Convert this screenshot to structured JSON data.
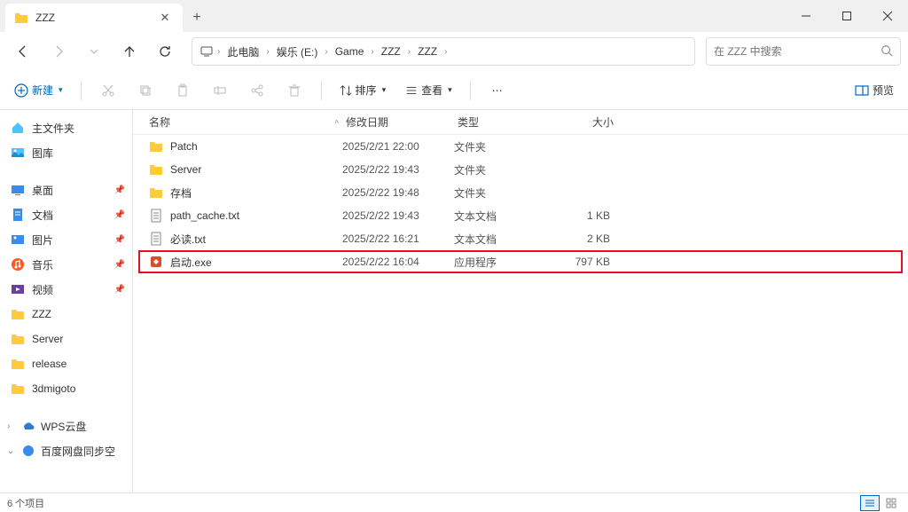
{
  "window": {
    "title": "ZZZ"
  },
  "toolbar": {
    "new_label": "新建",
    "sort_label": "排序",
    "view_label": "查看",
    "preview_label": "预览"
  },
  "breadcrumb": [
    "此电脑",
    "娱乐 (E:)",
    "Game",
    "ZZZ",
    "ZZZ"
  ],
  "search": {
    "placeholder": "在 ZZZ 中搜索"
  },
  "sidebar": {
    "home": "主文件夹",
    "gallery": "图库",
    "quick": [
      {
        "label": "桌面",
        "pinned": true,
        "icon": "desktop"
      },
      {
        "label": "文档",
        "pinned": true,
        "icon": "document"
      },
      {
        "label": "图片",
        "pinned": true,
        "icon": "picture"
      },
      {
        "label": "音乐",
        "pinned": true,
        "icon": "music"
      },
      {
        "label": "视频",
        "pinned": true,
        "icon": "video"
      },
      {
        "label": "ZZZ",
        "pinned": false,
        "icon": "folder"
      },
      {
        "label": "Server",
        "pinned": false,
        "icon": "folder"
      },
      {
        "label": "release",
        "pinned": false,
        "icon": "folder"
      },
      {
        "label": "3dmigoto",
        "pinned": false,
        "icon": "folder"
      }
    ],
    "cloud": [
      {
        "label": "WPS云盘",
        "expand": ">"
      },
      {
        "label": "百度网盘同步空",
        "expand": "v"
      }
    ]
  },
  "columns": {
    "name": "名称",
    "date": "修改日期",
    "type": "类型",
    "size": "大小"
  },
  "files": [
    {
      "name": "Patch",
      "date": "2025/2/21 22:00",
      "type": "文件夹",
      "size": "",
      "icon": "folder",
      "highlight": false
    },
    {
      "name": "Server",
      "date": "2025/2/22 19:43",
      "type": "文件夹",
      "size": "",
      "icon": "folder",
      "highlight": false
    },
    {
      "name": "存档",
      "date": "2025/2/22 19:48",
      "type": "文件夹",
      "size": "",
      "icon": "folder",
      "highlight": false
    },
    {
      "name": "path_cache.txt",
      "date": "2025/2/22 19:43",
      "type": "文本文档",
      "size": "1 KB",
      "icon": "txt",
      "highlight": false
    },
    {
      "name": "必读.txt",
      "date": "2025/2/22 16:21",
      "type": "文本文档",
      "size": "2 KB",
      "icon": "txt",
      "highlight": false
    },
    {
      "name": "启动.exe",
      "date": "2025/2/22 16:04",
      "type": "应用程序",
      "size": "797 KB",
      "icon": "exe",
      "highlight": true
    }
  ],
  "status": {
    "count": "6 个项目"
  }
}
